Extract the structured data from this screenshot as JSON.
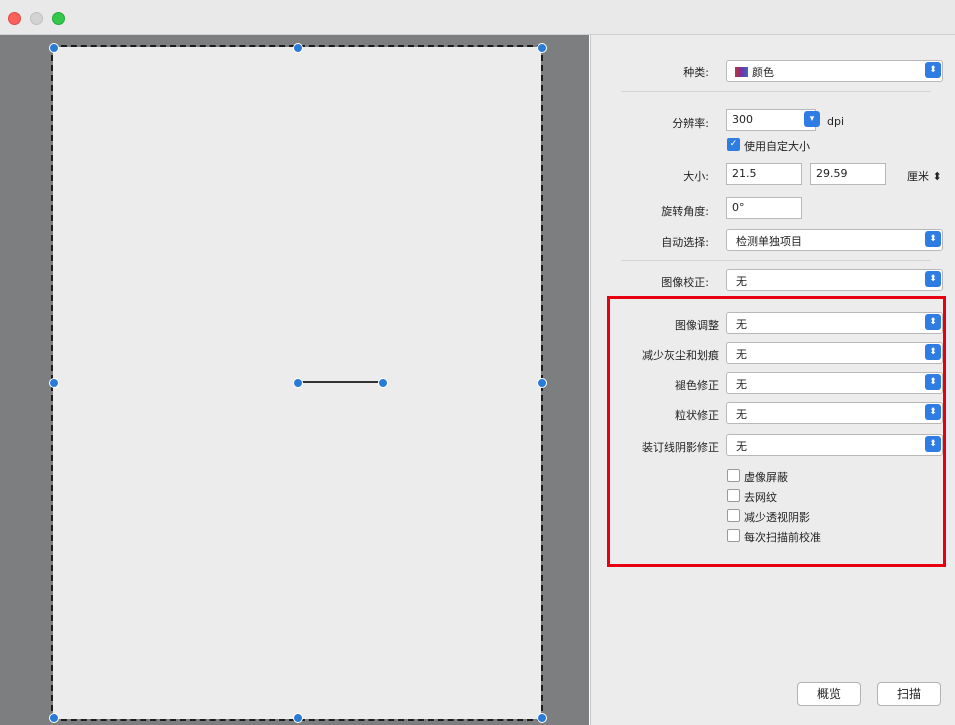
{
  "window": {
    "controls": [
      "close",
      "minimize",
      "zoom"
    ]
  },
  "settings": {
    "kind": {
      "label": "种类:",
      "value": "颜色"
    },
    "resolution": {
      "label": "分辨率:",
      "value": "300",
      "unit": "dpi"
    },
    "custom_size": {
      "label": "使用自定大小",
      "checked": true
    },
    "size": {
      "label": "大小:",
      "width": "21.5",
      "height": "29.59",
      "unit": "厘米"
    },
    "rotation": {
      "label": "旋转角度:",
      "value": "0°"
    },
    "auto_select": {
      "label": "自动选择:",
      "value": "检测单独项目"
    },
    "image_correction": {
      "label": "图像校正:",
      "value": "无"
    }
  },
  "adjustments": {
    "image_adjust": {
      "label": "图像调整",
      "value": "无"
    },
    "dust_reduction": {
      "label": "减少灰尘和划痕",
      "value": "无"
    },
    "fading_correction": {
      "label": "褪色修正",
      "value": "无"
    },
    "grain_correction": {
      "label": "粒状修正",
      "value": "无"
    },
    "gutter_correction": {
      "label": "装订线阴影修正",
      "value": "无"
    },
    "checkboxes": [
      {
        "label": "虚像屏蔽",
        "checked": false
      },
      {
        "label": "去网纹",
        "checked": false
      },
      {
        "label": "减少透视阴影",
        "checked": false
      },
      {
        "label": "每次扫描前校准",
        "checked": false
      }
    ]
  },
  "buttons": {
    "preview": "概览",
    "scan": "扫描"
  },
  "colors": {
    "accent": "#2f7de3",
    "highlight_box": "#e60012"
  },
  "icons": {
    "kind_icon": "color-icon",
    "popup_arrow": "updown-arrows-icon"
  }
}
